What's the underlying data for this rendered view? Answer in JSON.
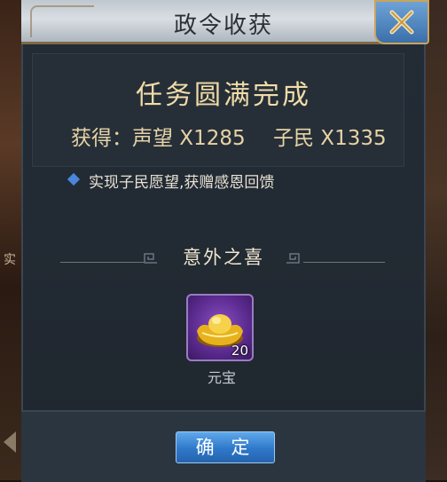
{
  "dialog": {
    "title": "政令收获",
    "headline": "任务圆满完成",
    "reward_prestige": "获得：声望 X1285",
    "reward_people": "子民 X1335",
    "description": "实现子民愿望,获赠感恩回馈",
    "section_title": "意外之喜",
    "item": {
      "name": "元宝",
      "count": "20",
      "icon": "gold-ingot-icon"
    },
    "confirm_label": "确 定"
  },
  "background": {
    "left_text": "实"
  },
  "colors": {
    "headline": "#f1dca8",
    "button": "#2f78c9",
    "item_slot": "#5a2a8e"
  }
}
